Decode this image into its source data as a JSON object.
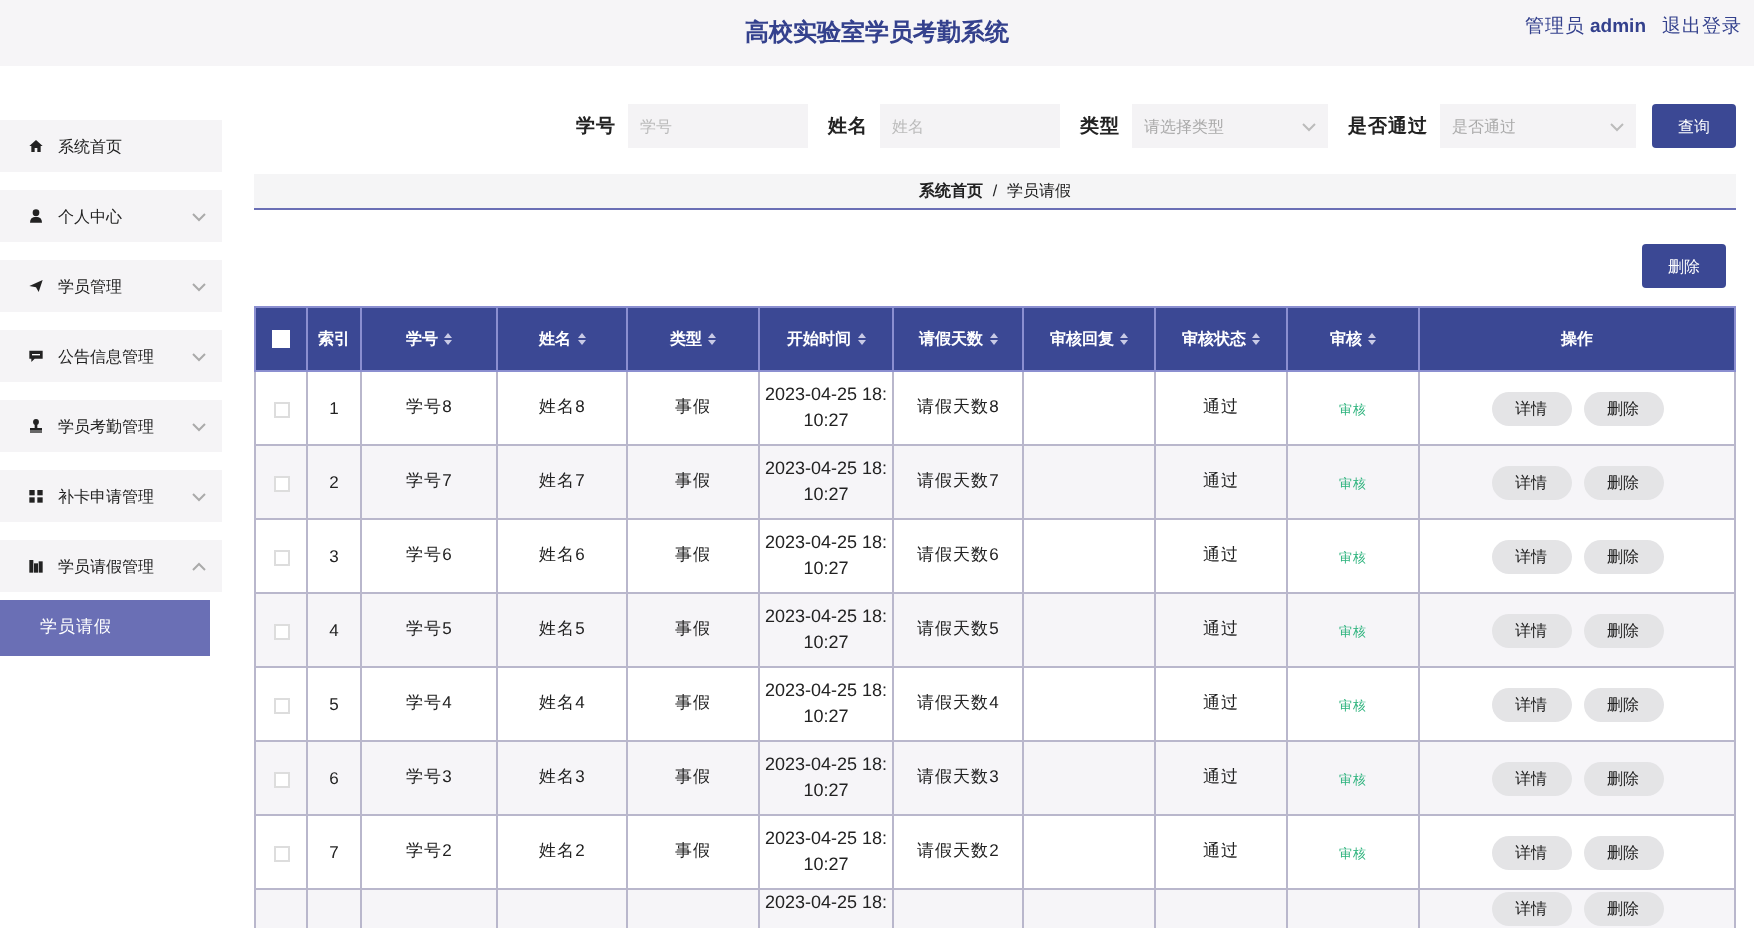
{
  "header": {
    "title": "高校实验室学员考勤系统",
    "user_role": "管理员",
    "user_name": "admin",
    "logout": "退出登录"
  },
  "sidebar": {
    "items": [
      {
        "label": "系统首页",
        "kind": "link"
      },
      {
        "label": "个人中心",
        "kind": "menu",
        "expanded": false
      },
      {
        "label": "学员管理",
        "kind": "menu",
        "expanded": false
      },
      {
        "label": "公告信息管理",
        "kind": "menu",
        "expanded": false
      },
      {
        "label": "学员考勤管理",
        "kind": "menu",
        "expanded": false
      },
      {
        "label": "补卡申请管理",
        "kind": "menu",
        "expanded": false
      },
      {
        "label": "学员请假管理",
        "kind": "menu",
        "expanded": true,
        "children": [
          {
            "label": "学员请假",
            "selected": true
          }
        ]
      }
    ]
  },
  "search": {
    "fields": [
      {
        "label": "学号",
        "placeholder": "学号",
        "kind": "input"
      },
      {
        "label": "姓名",
        "placeholder": "姓名",
        "kind": "input"
      },
      {
        "label": "类型",
        "placeholder": "请选择类型",
        "kind": "select"
      },
      {
        "label": "是否通过",
        "placeholder": "是否通过",
        "kind": "select"
      }
    ],
    "button": "查询"
  },
  "breadcrumb": {
    "items": [
      "系统首页",
      "学员请假"
    ],
    "separator": "/"
  },
  "bulk_delete": "删除",
  "table": {
    "select_all_checked": false,
    "columns": [
      {
        "label": "索引",
        "kind": "plain"
      },
      {
        "label": "学号",
        "kind": "sortable"
      },
      {
        "label": "姓名",
        "kind": "sortable"
      },
      {
        "label": "类型",
        "kind": "sortable"
      },
      {
        "label": "开始时间",
        "kind": "sortable"
      },
      {
        "label": "请假天数",
        "kind": "sortable"
      },
      {
        "label": "审核回复",
        "kind": "sortable"
      },
      {
        "label": "审核状态",
        "kind": "sortable"
      },
      {
        "label": "审核",
        "kind": "sortable"
      },
      {
        "label": "操作",
        "kind": "plain"
      }
    ],
    "rows": [
      {
        "checked": false,
        "index": "1",
        "student_id": "学号8",
        "name": "姓名8",
        "type": "事假",
        "start_time": "2023-04-25 18:10:27",
        "days": "请假天数8",
        "status": "通过",
        "review": "审核",
        "actions": [
          "详情",
          "删除"
        ]
      },
      {
        "checked": false,
        "index": "2",
        "student_id": "学号7",
        "name": "姓名7",
        "type": "事假",
        "start_time": "2023-04-25 18:10:27",
        "days": "请假天数7",
        "status": "通过",
        "review": "审核",
        "actions": [
          "详情",
          "删除"
        ]
      },
      {
        "checked": false,
        "index": "3",
        "student_id": "学号6",
        "name": "姓名6",
        "type": "事假",
        "start_time": "2023-04-25 18:10:27",
        "days": "请假天数6",
        "status": "通过",
        "review": "审核",
        "actions": [
          "详情",
          "删除"
        ]
      },
      {
        "checked": false,
        "index": "4",
        "student_id": "学号5",
        "name": "姓名5",
        "type": "事假",
        "start_time": "2023-04-25 18:10:27",
        "days": "请假天数5",
        "status": "通过",
        "review": "审核",
        "actions": [
          "详情",
          "删除"
        ]
      },
      {
        "checked": false,
        "index": "5",
        "student_id": "学号4",
        "name": "姓名4",
        "type": "事假",
        "start_time": "2023-04-25 18:10:27",
        "days": "请假天数4",
        "status": "通过",
        "review": "审核",
        "actions": [
          "详情",
          "删除"
        ]
      },
      {
        "checked": false,
        "index": "6",
        "student_id": "学号3",
        "name": "姓名3",
        "type": "事假",
        "start_time": "2023-04-25 18:10:27",
        "days": "请假天数3",
        "status": "通过",
        "review": "审核",
        "actions": [
          "详情",
          "删除"
        ]
      },
      {
        "checked": false,
        "index": "7",
        "student_id": "学号2",
        "name": "姓名2",
        "type": "事假",
        "start_time": "2023-04-25 18:10:27",
        "days": "请假天数2",
        "status": "通过",
        "review": "审核",
        "actions": [
          "详情",
          "删除"
        ]
      },
      {
        "start_time": "2023-04-25 18:",
        "actions": [
          "详情",
          "删除"
        ]
      }
    ]
  }
}
